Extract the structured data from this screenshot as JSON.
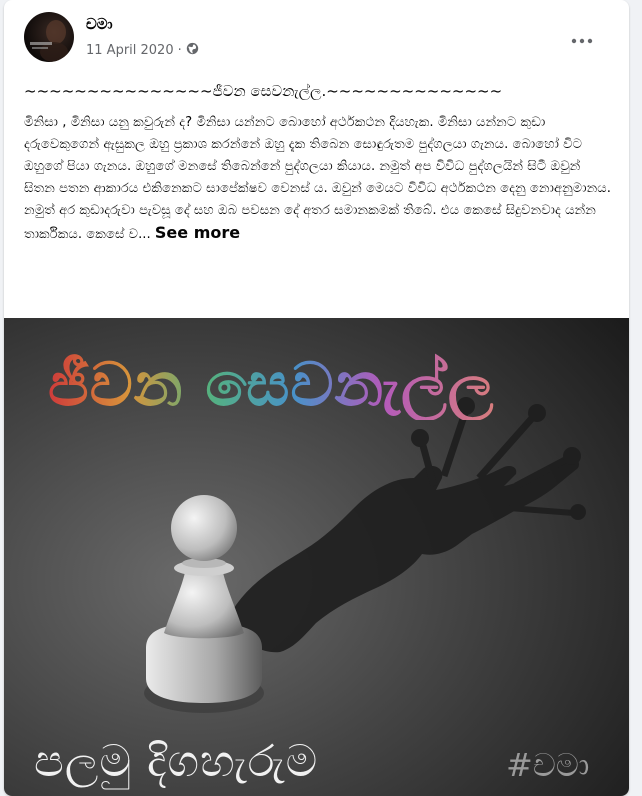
{
  "post": {
    "author": "චමා",
    "date": "11 April 2020",
    "separator": "·",
    "heading": "~~~~~~~~~~~~~~~ජීවන සෙවනැල්ල.~~~~~~~~~~~~~~",
    "body": "මිනිසා , මිනිසා යනු කවුරුන් ද? මිනිසා යන්නට බොහෝ අර්ථකථන දියහැක. මිනිසා යන්නට කුඩා දරුවෙකුගෙන් ඇසුකල ඔහු ප්‍රකාශ කරන්නේ ඔහු දැක තිබෙන සොඳුරුතම පුද්ගලයා ගැනය. බොහෝ විට ඔහුගේ පියා ගැනය. ඔහුගේ මනසේ තිබෙන්නේ පුද්ගලයා කියාය. නමුත් අප විවිධ පුද්ගලයින් සිටී ඔවුන් සිතන පතන ආකාරය එකිනෙකට සාපේක්ෂව වෙනස් ය. ඔවුන් මෙයට විවිධ අර්ථකථන දෙනු නොඅනුමානය. නමුත් අර කුඩාදරුවා පැවසූ දේ සහ ඔබ පවසන දේ අතර සමානකමක් තිබේ. එය කෙසේ සිදුවනවාද යන්න තාර්කිකය. කෙසේ ව...",
    "see_more": "See more"
  },
  "image": {
    "title_text": "ජීවන සෙවනැල්ල",
    "subtitle_text": "පලමු දිගහැරුම",
    "hashtag": "#චමා"
  },
  "icons": {
    "privacy": "globe-icon",
    "menu": "more-options-icon"
  },
  "colors": {
    "background": "#f0f2f5",
    "card": "#ffffff",
    "text_primary": "#050505",
    "text_secondary": "#65676b"
  }
}
